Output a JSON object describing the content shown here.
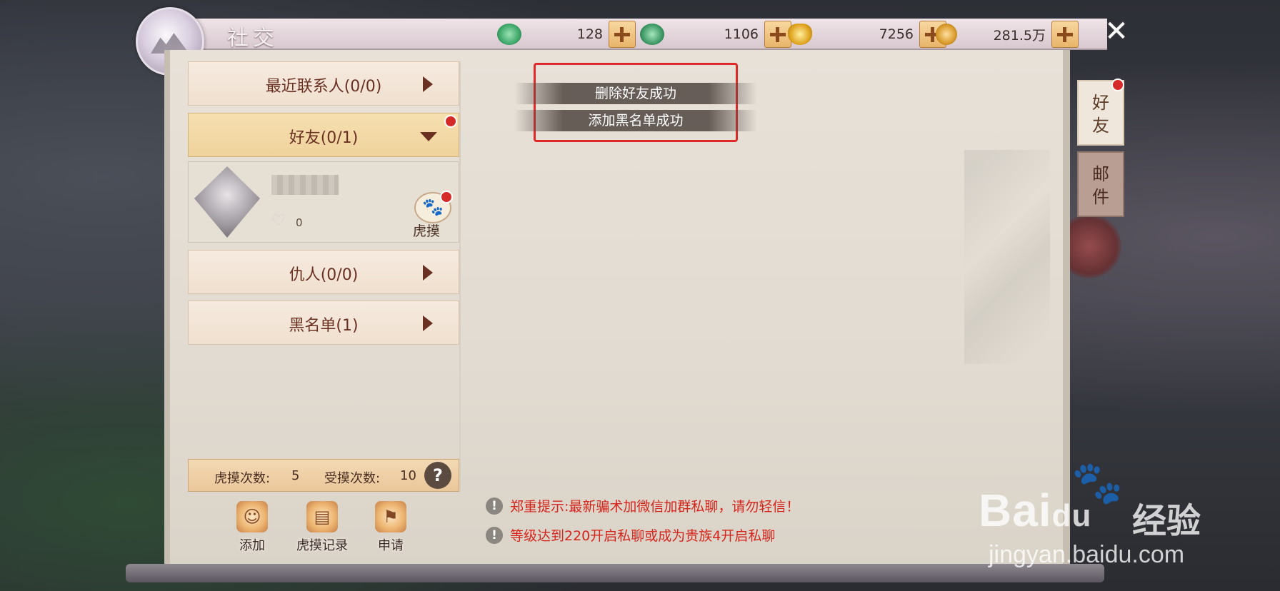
{
  "header": {
    "title": "社交",
    "currencies": [
      {
        "icon": "jade-icon",
        "value": "128",
        "color": "#3fa86a"
      },
      {
        "icon": "bound-jade-icon",
        "value": "1106",
        "color": "#3f9a66"
      },
      {
        "icon": "gold-ingot-icon",
        "value": "7256",
        "color": "#e0a520"
      },
      {
        "icon": "copper-coin-icon",
        "value": "281.5万",
        "color": "#d89a2a"
      }
    ]
  },
  "left_panel": {
    "categories": {
      "recent": "最近联系人(0/0)",
      "friends": "好友(0/1)",
      "enemies": "仇人(0/0)",
      "blacklist": "黑名单(1)"
    },
    "friend_card": {
      "likes": "0",
      "action_label": "虎摸"
    },
    "stats": {
      "pet_count_label": "虎摸次数:",
      "pet_count": "5",
      "received_label": "受摸次数:",
      "received_count": "10"
    },
    "bottom_buttons": {
      "add": "添加",
      "pet_log": "虎摸记录",
      "apply": "申请"
    }
  },
  "notifications": [
    "删除好友成功",
    "添加黑名单成功"
  ],
  "warnings": [
    "郑重提示:最新骗术加微信加群私聊，请勿轻信！",
    "等级达到220开启私聊或成为贵族4开启私聊"
  ],
  "side_tabs": {
    "friends": "好友",
    "mail": "邮件"
  },
  "watermark": {
    "brand": "Bai",
    "brand_du": "du",
    "suffix": "经验",
    "url": "jingyan.baidu.com"
  },
  "colors": {
    "accent_red": "#d6241b",
    "button_brown": "#6a3022",
    "highlight_box": "#e02a2a"
  }
}
